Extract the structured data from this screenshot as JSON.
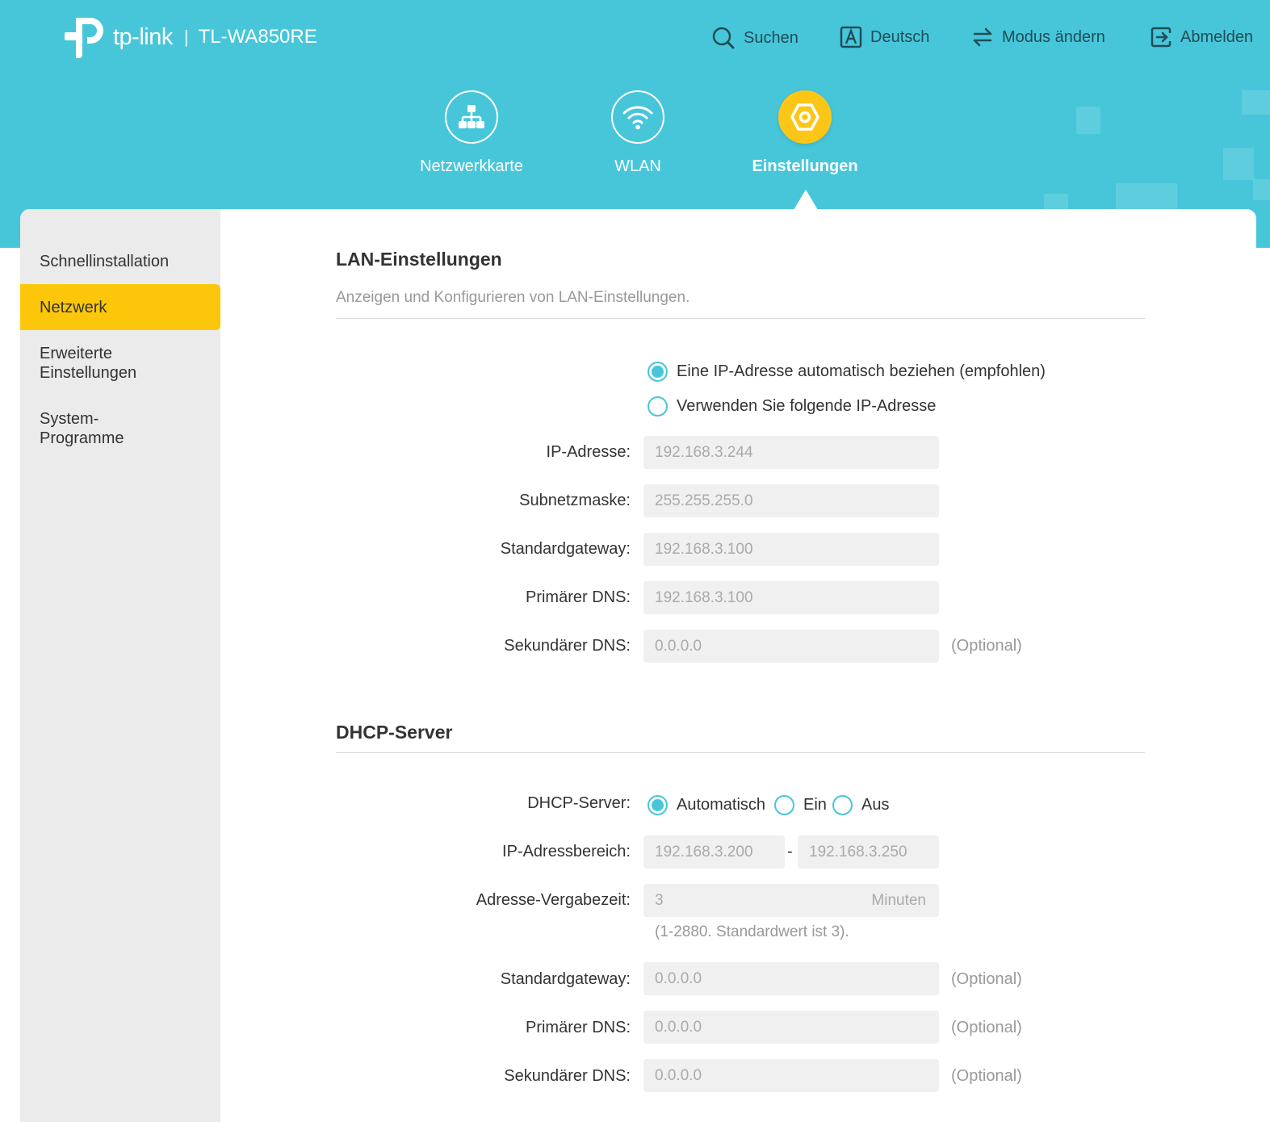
{
  "brand": {
    "logo_text": "tp-link",
    "separator": "|",
    "model": "TL-WA850RE"
  },
  "top_actions": {
    "search": "Suchen",
    "language": "Deutsch",
    "mode": "Modus ändern",
    "logout": "Abmelden"
  },
  "nav": {
    "network_map": "Netzwerkkarte",
    "wlan": "WLAN",
    "settings": "Einstellungen",
    "active": "settings"
  },
  "sidebar": {
    "items": [
      {
        "label": "Schnellinstallation",
        "active": false
      },
      {
        "label": "Netzwerk",
        "active": true
      },
      {
        "label_line1": "Erweiterte",
        "label_line2": "Einstellungen",
        "active": false
      },
      {
        "label_line1": "System-",
        "label_line2": "Programme",
        "active": false
      }
    ]
  },
  "lan": {
    "title": "LAN-Einstellungen",
    "description": "Anzeigen und Konfigurieren von LAN-Einstellungen.",
    "options": [
      {
        "label": "Eine IP-Adresse automatisch beziehen (empfohlen)",
        "selected": true
      },
      {
        "label": "Verwenden Sie folgende IP-Adresse",
        "selected": false
      }
    ],
    "fields": {
      "ip": {
        "label": "IP-Adresse:",
        "value": "192.168.3.244"
      },
      "subnet": {
        "label": "Subnetzmaske:",
        "value": "255.255.255.0"
      },
      "gateway": {
        "label": "Standardgateway:",
        "value": "192.168.3.100"
      },
      "dns1": {
        "label": "Primärer DNS:",
        "value": "192.168.3.100"
      },
      "dns2": {
        "label": "Sekundärer DNS:",
        "value": "0.0.0.0",
        "note": "(Optional)"
      }
    }
  },
  "dhcp": {
    "title": "DHCP-Server",
    "server_label": "DHCP-Server:",
    "modes": [
      {
        "label": "Automatisch",
        "selected": true
      },
      {
        "label": "Ein",
        "selected": false
      },
      {
        "label": "Aus",
        "selected": false
      }
    ],
    "range": {
      "label": "IP-Adressbereich:",
      "start": "192.168.3.200",
      "separator": "-",
      "end": "192.168.3.250"
    },
    "lease": {
      "label": "Adresse-Vergabezeit:",
      "value": "3",
      "unit": "Minuten",
      "hint": "(1-2880. Standardwert ist 3)."
    },
    "gateway": {
      "label": "Standardgateway:",
      "value": "0.0.0.0",
      "note": "(Optional)"
    },
    "dns1": {
      "label": "Primärer DNS:",
      "value": "0.0.0.0",
      "note": "(Optional)"
    },
    "dns2": {
      "label": "Sekundärer DNS:",
      "value": "0.0.0.0",
      "note": "(Optional)"
    }
  },
  "colors": {
    "header": "#47c6da",
    "accent_yellow": "#fcc617",
    "radio": "#47c6da",
    "sidebar": "#ebebec"
  }
}
